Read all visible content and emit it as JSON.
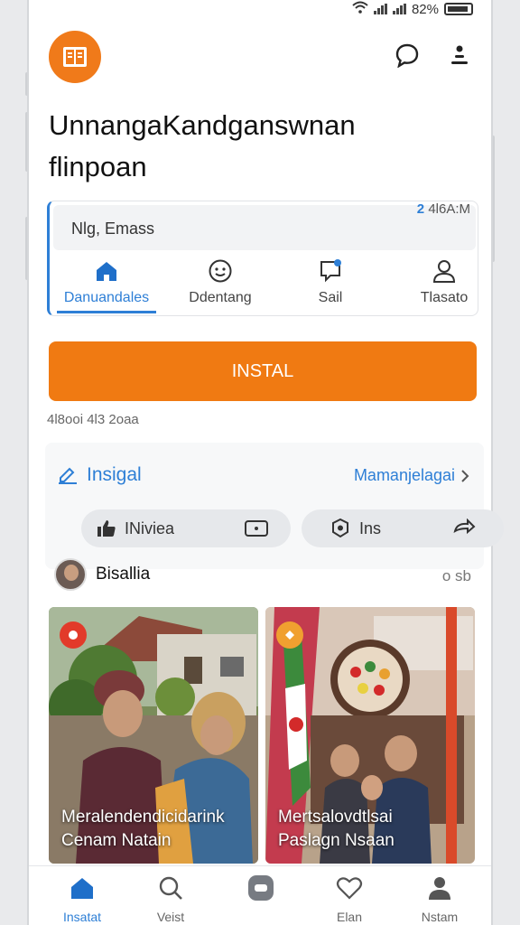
{
  "status_bar": {
    "battery_text": "82%"
  },
  "header": {
    "title_line1": "UnnangaKandganswnan",
    "title_line2": "flinpoan"
  },
  "search": {
    "value": "Nlg, Emass",
    "time_count": "2",
    "time_text": "4l6A:M"
  },
  "tabs": [
    {
      "label": "Danuandales",
      "icon": "home-icon",
      "active": true
    },
    {
      "label": "Ddentang",
      "icon": "smiley-icon"
    },
    {
      "label": "Sail",
      "icon": "chat-icon"
    },
    {
      "label": "Tlasato",
      "icon": "person-icon"
    }
  ],
  "install": {
    "button_label": "INSTAL",
    "meta": "4l8ooi 4l3 2oaa"
  },
  "section": {
    "title": "Insigal",
    "link": "Mamanjelagai",
    "pills": [
      {
        "label": "INiviea"
      },
      {
        "label": "Ins"
      }
    ]
  },
  "post": {
    "author": "Bisallia",
    "meta": "o sb",
    "cards": [
      {
        "caption_line1": "Meralendendicidarink",
        "caption_line2": "Cenam Natain"
      },
      {
        "caption_line1": "Mertsalovdtlsai",
        "caption_line2": "Paslagn Nsaan"
      }
    ]
  },
  "bottom_nav": [
    {
      "label": "Insatat",
      "icon": "home-icon",
      "active": true
    },
    {
      "label": "Veist",
      "icon": "search-icon"
    },
    {
      "label": "",
      "icon": "app-icon"
    },
    {
      "label": "Elan",
      "icon": "heart-icon"
    },
    {
      "label": "Nstam",
      "icon": "profile-icon"
    }
  ],
  "colors": {
    "accent_blue": "#2e7fd6",
    "accent_orange": "#f07a12"
  }
}
